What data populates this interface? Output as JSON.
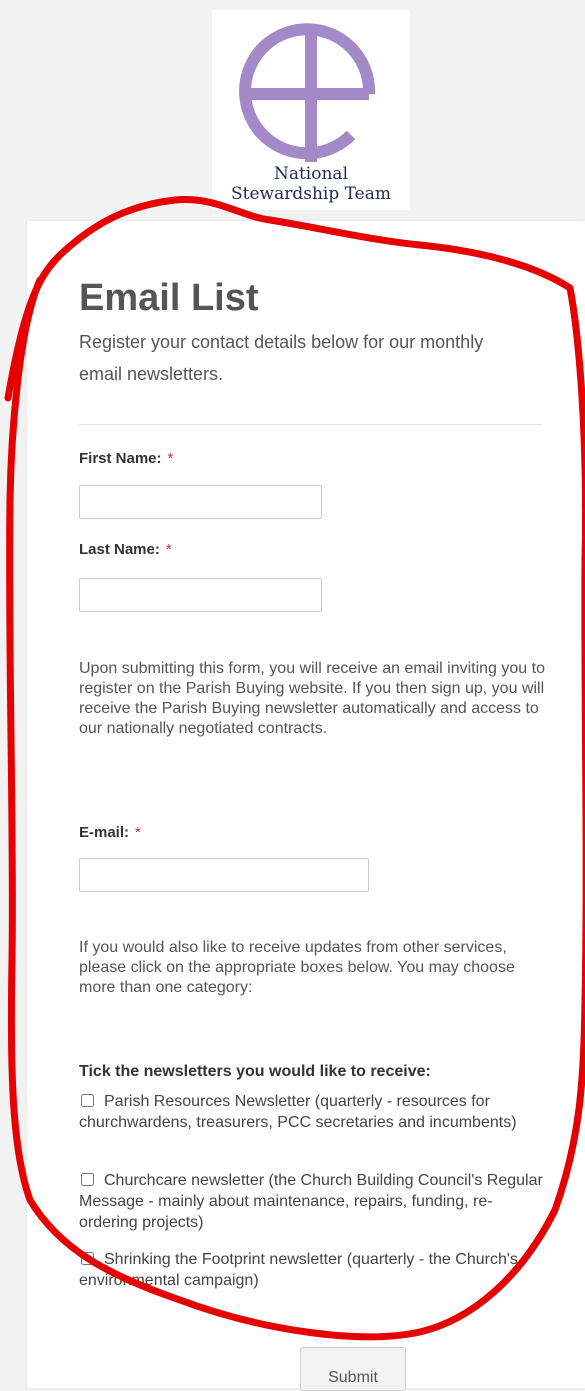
{
  "logo": {
    "line1": "National",
    "line2": "Stewardship Team",
    "accent_color": "#a389c8"
  },
  "form": {
    "title": "Email List",
    "subtitle": "Register your contact details below for our monthly email newsletters.",
    "first_name": {
      "label": "First Name:",
      "required_mark": "*",
      "value": ""
    },
    "last_name": {
      "label": "Last Name:",
      "required_mark": "*",
      "value": ""
    },
    "info_text": "Upon submitting this form, you will receive an email inviting you to register on the Parish Buying website. If you then sign up, you will receive the Parish Buying newsletter automatically and access to our nationally negotiated contracts.",
    "email": {
      "label": "E-mail:",
      "required_mark": "*",
      "value": ""
    },
    "updates_text": "If you would also like to receive updates from other services, please click on the appropriate boxes below. You may choose more than one category:",
    "newsletter_heading": "Tick the newsletters you would like to receive:",
    "newsletters": [
      {
        "label": "Parish Resources Newsletter (quarterly - resources for churchwardens, treasurers, PCC secretaries and incumbents)",
        "checked": false
      },
      {
        "label": "Churchcare newsletter (the Church Building Council's Regular Message - mainly about maintenance, repairs, funding, re-ordering projects)",
        "checked": false
      },
      {
        "label": "Shrinking the Footprint newsletter (quarterly - the Church's environmental campaign)",
        "checked": false
      }
    ],
    "submit_label": "Submit"
  },
  "colors": {
    "required": "#c0392b",
    "annotation": "#e60000"
  }
}
